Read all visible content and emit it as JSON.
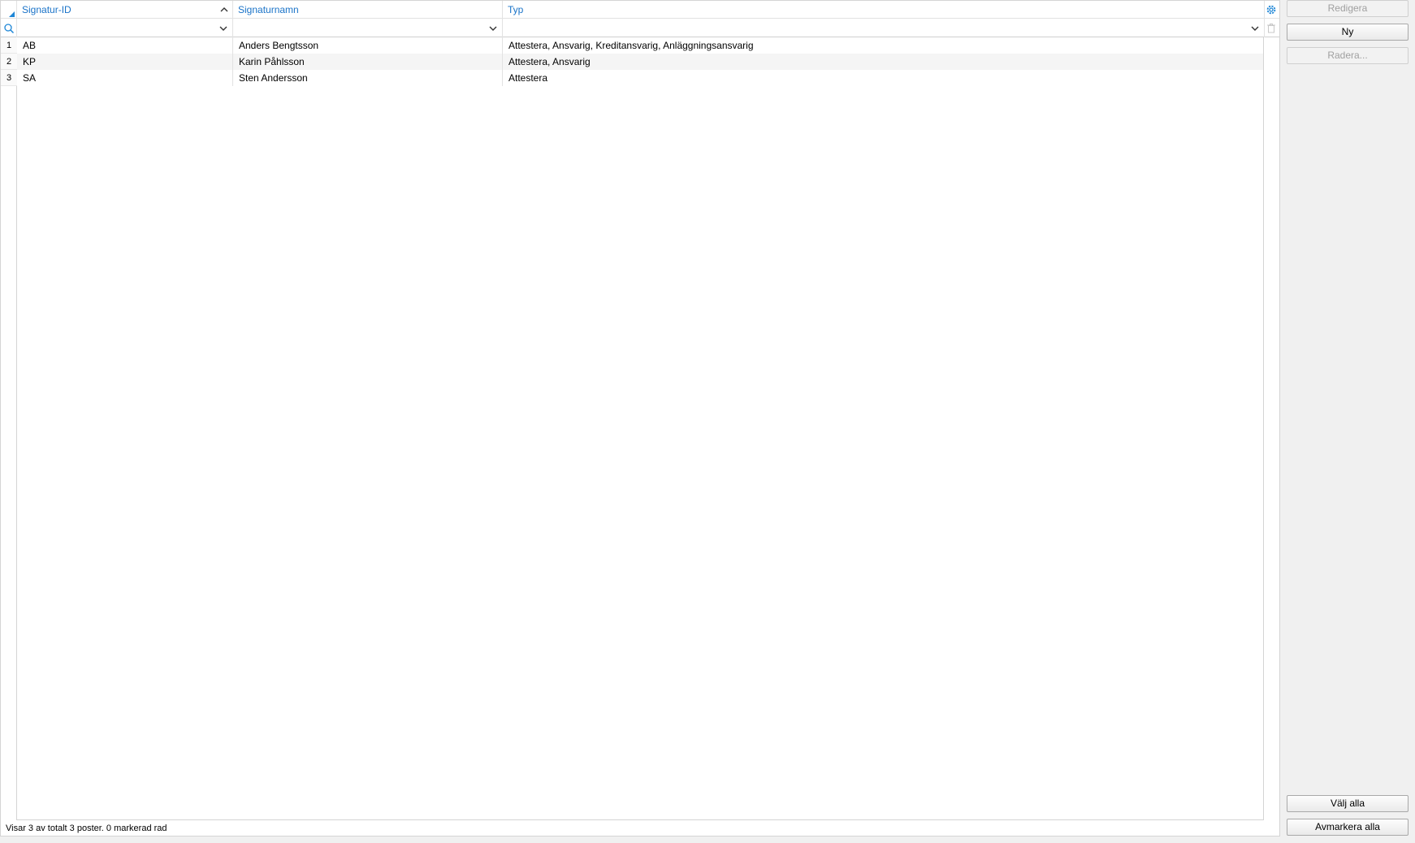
{
  "grid": {
    "columns": [
      {
        "label": "Signatur-ID"
      },
      {
        "label": "Signaturnamn"
      },
      {
        "label": "Typ"
      }
    ],
    "rows": [
      {
        "num": "1",
        "id": "AB",
        "name": "Anders Bengtsson",
        "type": "Attestera, Ansvarig, Kreditansvarig, Anläggningsansvarig"
      },
      {
        "num": "2",
        "id": "KP",
        "name": "Karin Påhlsson",
        "type": "Attestera, Ansvarig"
      },
      {
        "num": "3",
        "id": "SA",
        "name": "Sten Andersson",
        "type": "Attestera"
      }
    ],
    "sorted_column": "Signatur-ID",
    "sort_direction": "ascending"
  },
  "status": {
    "text": "Visar 3 av totalt 3 poster. 0 markerad rad"
  },
  "buttons": {
    "edit": "Redigera",
    "new": "Ny",
    "delete": "Radera...",
    "select_all": "Välj alla",
    "deselect_all": "Avmarkera alla"
  },
  "colors": {
    "header_text": "#1a73c8",
    "accent": "#1e86d6",
    "disabled_text": "#a0a0a0"
  }
}
